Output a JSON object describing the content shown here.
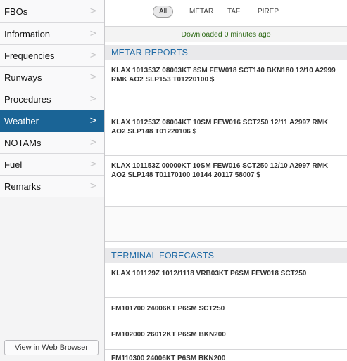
{
  "sidebar": {
    "items": [
      {
        "label": "FBOs"
      },
      {
        "label": "Information"
      },
      {
        "label": "Frequencies"
      },
      {
        "label": "Runways"
      },
      {
        "label": "Procedures"
      },
      {
        "label": "Weather"
      },
      {
        "label": "NOTAMs"
      },
      {
        "label": "Fuel"
      },
      {
        "label": "Remarks"
      }
    ],
    "active_item": "Weather",
    "web_button": "View in Web Browser",
    "chevron_glyph": ">"
  },
  "tabs": {
    "items": [
      "All",
      "METAR",
      "TAF",
      "PIREP"
    ],
    "selected": "All"
  },
  "status": {
    "downloaded": "Downloaded 0 minutes ago"
  },
  "metar": {
    "header": "METAR REPORTS",
    "reports": [
      "KLAX 101353Z 08003KT 8SM FEW018 SCT140 BKN180 12/10 A2999 RMK AO2 SLP153 T01220100 $",
      "KLAX 101253Z 08004KT 10SM FEW016 SCT250 12/11 A2997 RMK AO2 SLP148 T01220106 $",
      "KLAX 101153Z 00000KT 10SM FEW016 SCT250 12/10 A2997 RMK AO2 SLP148 T01170100 10144 20117 58007 $"
    ]
  },
  "taf": {
    "header": "TERMINAL FORECASTS",
    "lines": [
      "KLAX 101129Z 1012/1118 VRB03KT P6SM FEW018 SCT250",
      "FM101700 24006KT P6SM SCT250",
      "FM102000 26012KT P6SM BKN200",
      "FM110300 24006KT P6SM BKN200"
    ]
  },
  "colors": {
    "accent": "#1a6496",
    "section_title": "#1f6aa5",
    "status_green": "#2d6a15"
  }
}
